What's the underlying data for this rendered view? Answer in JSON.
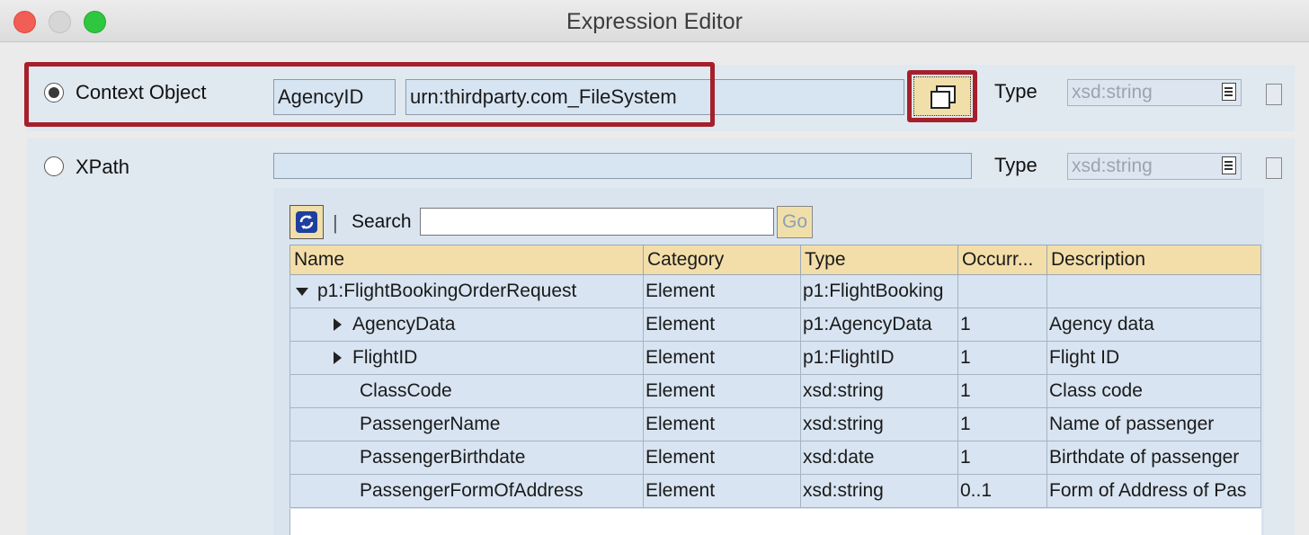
{
  "window": {
    "title": "Expression Editor"
  },
  "context_object": {
    "label": "Context Object",
    "selected": true,
    "name_value": "AgencyID",
    "namespace_value": "urn:thirdparty.com_FileSystem",
    "type_label": "Type",
    "type_value": "xsd:string"
  },
  "xpath": {
    "label": "XPath",
    "selected": false,
    "value": "",
    "type_label": "Type",
    "type_value": "xsd:string"
  },
  "toolbar": {
    "search_label": "Search",
    "search_value": "",
    "go_label": "Go",
    "separator": "|"
  },
  "table": {
    "columns": [
      "Name",
      "Category",
      "Type",
      "Occurr...",
      "Description"
    ],
    "rows": [
      {
        "expander": "expanded",
        "name": "p1:FlightBookingOrderRequest",
        "category": "Element",
        "type": "p1:FlightBooking",
        "occurrence": "",
        "description": ""
      },
      {
        "expander": "collapsed",
        "name": "AgencyData",
        "category": "Element",
        "type": "p1:AgencyData",
        "occurrence": "1",
        "description": "Agency data"
      },
      {
        "expander": "collapsed",
        "name": "FlightID",
        "category": "Element",
        "type": "p1:FlightID",
        "occurrence": "1",
        "description": "Flight ID"
      },
      {
        "expander": "none",
        "name": "ClassCode",
        "category": "Element",
        "type": "xsd:string",
        "occurrence": "1",
        "description": "Class code"
      },
      {
        "expander": "none",
        "name": "PassengerName",
        "category": "Element",
        "type": "xsd:string",
        "occurrence": "1",
        "description": "Name of passenger"
      },
      {
        "expander": "none",
        "name": "PassengerBirthdate",
        "category": "Element",
        "type": "xsd:date",
        "occurrence": "1",
        "description": "Birthdate of passenger"
      },
      {
        "expander": "none",
        "name": "PassengerFormOfAddress",
        "category": "Element",
        "type": "xsd:string",
        "occurrence": "0..1",
        "description": "Form of Address of Pas"
      }
    ]
  },
  "colors": {
    "highlight": "#a5202a",
    "header": "#f3deaa",
    "cell": "#d8e4f1",
    "button": "#f1dfa9"
  }
}
